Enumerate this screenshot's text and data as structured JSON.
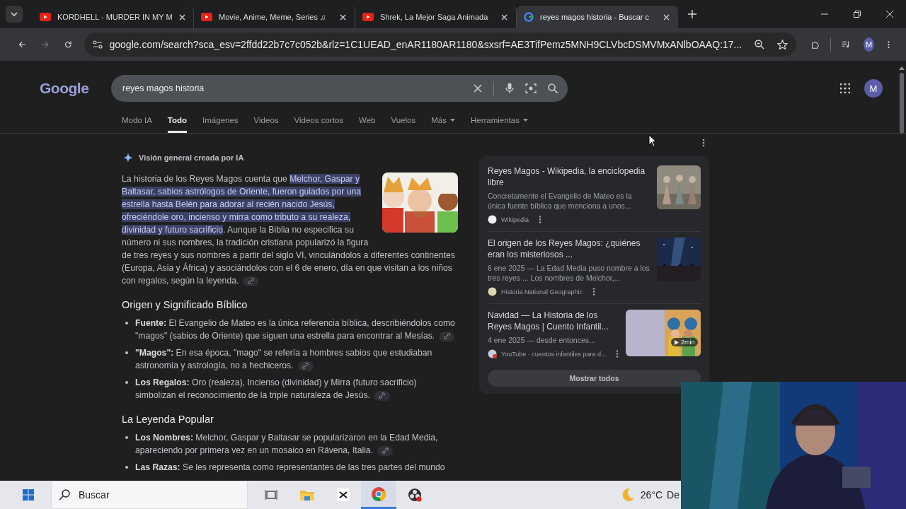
{
  "browser": {
    "tabs": [
      {
        "title": "KORDHELL - MURDER IN MY M",
        "kind": "youtube",
        "selected": false
      },
      {
        "title": "Movie, Anime, Meme, Series ♫",
        "kind": "youtube",
        "selected": false
      },
      {
        "title": "Shrek, La Mejor Saga Animada",
        "kind": "youtube",
        "selected": false
      },
      {
        "title": "reyes magos historia - Buscar c",
        "kind": "google",
        "selected": true
      }
    ],
    "url": "google.com/search?sca_esv=2ffdd22b7c7c052b&rlz=1C1UEAD_enAR1180AR1180&sxsrf=AE3TifPemz5MNH9CLVbcDSMVMxANlbOAAQ:17...",
    "profile_initial": "M"
  },
  "search": {
    "logo": "Google",
    "query": "reyes magos historia",
    "profile_initial": "M",
    "nav": [
      {
        "label": "Modo IA",
        "kind": "plain",
        "selected": false
      },
      {
        "label": "Todo",
        "kind": "plain",
        "selected": true
      },
      {
        "label": "Imágenes",
        "kind": "plain",
        "selected": false
      },
      {
        "label": "Videos",
        "kind": "plain",
        "selected": false
      },
      {
        "label": "Videos cortos",
        "kind": "plain",
        "selected": false
      },
      {
        "label": "Web",
        "kind": "plain",
        "selected": false
      },
      {
        "label": "Vuelos",
        "kind": "plain",
        "selected": false
      },
      {
        "label": "Más",
        "kind": "dropdown",
        "selected": false
      },
      {
        "label": "Herramientas",
        "kind": "dropdown",
        "selected": false
      }
    ]
  },
  "ai_overview": {
    "title": "Visión general creada por IA",
    "intro": {
      "before": "La historia de los Reyes Magos cuenta que ",
      "highlighted": "Melchor, Gaspar y Baltasar, sabios astrólogos de Oriente, fueron guiados por una estrella hasta Belén para adorar al recién nacido Jesús, ofreciéndole oro, incienso y mirra como tributo a su realeza, divinidad y futuro sacrificio",
      "after": ". Aunque la Biblia no especifica su número ni sus nombres, la tradición cristiana popularizó la figura de tres reyes y sus nombres a partir del siglo VI, vinculándolos a diferentes continentes (Europa, Asia y África) y asociándolos con el 6 de enero, día en que visitan a los niños con regalos, según la leyenda."
    },
    "sections": [
      {
        "heading": "Origen y Significado Bíblico",
        "items": [
          {
            "term": "Fuente:",
            "text": "El Evangelio de Mateo es la única referencia bíblica, describiéndolos como \"magos\" (sabios de Oriente) que siguen una estrella para encontrar al Mesías."
          },
          {
            "term": "\"Magos\":",
            "text": "En esa época, \"mago\" se refería a hombres sabios que estudiaban astronomía y astrología, no a hechiceros."
          },
          {
            "term": "Los Regalos:",
            "text": "Oro (realeza), Incienso (divinidad) y Mirra (futuro sacrificio) simbolizan el reconocimiento de la triple naturaleza de Jesús."
          }
        ]
      },
      {
        "heading": "La Leyenda Popular",
        "items": [
          {
            "term": "Los Nombres:",
            "text": "Melchor, Gaspar y Baltasar se popularizaron en la Edad Media, apareciendo por primera vez en un mosaico en Rávena, Italia."
          },
          {
            "term": "Las Razas:",
            "text": "Se les representa como representantes de las tres partes del mundo"
          }
        ]
      }
    ],
    "sources": [
      {
        "title": "Reyes Magos - Wikipedia, la enciclopedia libre",
        "snippet": "Concretamente el Evangelio de Mateo es la única fuente bíblica que menciona a unos...",
        "site": "Wikipedia",
        "kind": "wiki"
      },
      {
        "title": "El origen de los Reyes Magos: ¿quiénes eran los misteriosos ...",
        "snippet": "6 ene 2025 — La Edad Media puso nombre a los tres reyes ... Los nombres de Melchor,...",
        "site": "Historia National Geographic",
        "kind": "night"
      },
      {
        "title": "Navidad — La Historia de los Reyes Magos | Cuento Infantil...",
        "snippet": "4 ene 2025 — desde entonces...",
        "site": "YouTube · cuentos infantiles para d...",
        "kind": "video",
        "duration": "2min"
      }
    ],
    "show_all": "Mostrar todos"
  },
  "taskbar": {
    "search": "Buscar",
    "temperature": "26°C",
    "weather_text": "De"
  }
}
